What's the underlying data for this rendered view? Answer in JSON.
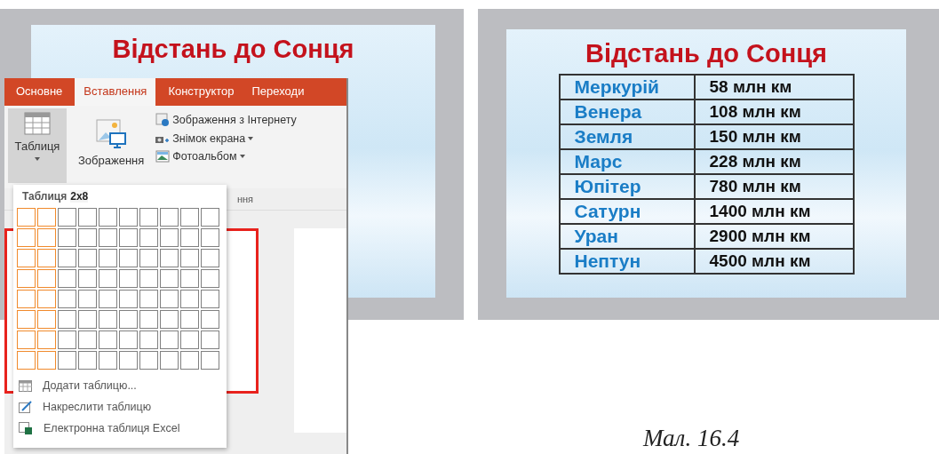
{
  "left_slide": {
    "title": "Відстань до Сонця"
  },
  "ribbon": {
    "tabs": [
      {
        "label": "Основне",
        "selected": false
      },
      {
        "label": "Вставлення",
        "selected": true
      },
      {
        "label": "Конструктор",
        "selected": false
      },
      {
        "label": "Переходи",
        "selected": false
      }
    ],
    "table_button": {
      "label": "Таблиця",
      "expanded": true
    },
    "picture_button": {
      "label": "Зображення"
    },
    "small_buttons": [
      {
        "label": "Зображення з Інтернету",
        "kind": "online",
        "dropdown": false
      },
      {
        "label": "Знімок екрана",
        "kind": "screenshot",
        "dropdown": true
      },
      {
        "label": "Фотоальбом",
        "kind": "album",
        "dropdown": true
      }
    ],
    "group_label": "ння"
  },
  "table_menu": {
    "header": "Таблиця",
    "size": "2x8",
    "grid": [
      {
        "cells": [
          {
            "selected": true
          },
          {
            "selected": true
          },
          {
            "selected": false
          },
          {
            "selected": false
          },
          {
            "selected": false
          },
          {
            "selected": false
          },
          {
            "selected": false
          },
          {
            "selected": false
          },
          {
            "selected": false
          },
          {
            "selected": false
          }
        ]
      },
      {
        "cells": [
          {
            "selected": true
          },
          {
            "selected": true
          },
          {
            "selected": false
          },
          {
            "selected": false
          },
          {
            "selected": false
          },
          {
            "selected": false
          },
          {
            "selected": false
          },
          {
            "selected": false
          },
          {
            "selected": false
          },
          {
            "selected": false
          }
        ]
      },
      {
        "cells": [
          {
            "selected": true
          },
          {
            "selected": true
          },
          {
            "selected": false
          },
          {
            "selected": false
          },
          {
            "selected": false
          },
          {
            "selected": false
          },
          {
            "selected": false
          },
          {
            "selected": false
          },
          {
            "selected": false
          },
          {
            "selected": false
          }
        ]
      },
      {
        "cells": [
          {
            "selected": true
          },
          {
            "selected": true
          },
          {
            "selected": false
          },
          {
            "selected": false
          },
          {
            "selected": false
          },
          {
            "selected": false
          },
          {
            "selected": false
          },
          {
            "selected": false
          },
          {
            "selected": false
          },
          {
            "selected": false
          }
        ]
      },
      {
        "cells": [
          {
            "selected": true
          },
          {
            "selected": true
          },
          {
            "selected": false
          },
          {
            "selected": false
          },
          {
            "selected": false
          },
          {
            "selected": false
          },
          {
            "selected": false
          },
          {
            "selected": false
          },
          {
            "selected": false
          },
          {
            "selected": false
          }
        ]
      },
      {
        "cells": [
          {
            "selected": true
          },
          {
            "selected": true
          },
          {
            "selected": false
          },
          {
            "selected": false
          },
          {
            "selected": false
          },
          {
            "selected": false
          },
          {
            "selected": false
          },
          {
            "selected": false
          },
          {
            "selected": false
          },
          {
            "selected": false
          }
        ]
      },
      {
        "cells": [
          {
            "selected": true
          },
          {
            "selected": true
          },
          {
            "selected": false
          },
          {
            "selected": false
          },
          {
            "selected": false
          },
          {
            "selected": false
          },
          {
            "selected": false
          },
          {
            "selected": false
          },
          {
            "selected": false
          },
          {
            "selected": false
          }
        ]
      },
      {
        "cells": [
          {
            "selected": true
          },
          {
            "selected": true
          },
          {
            "selected": false
          },
          {
            "selected": false
          },
          {
            "selected": false
          },
          {
            "selected": false
          },
          {
            "selected": false
          },
          {
            "selected": false
          },
          {
            "selected": false
          },
          {
            "selected": false
          }
        ]
      }
    ],
    "items": [
      {
        "label": "Додати таблицю...",
        "kind": "insert"
      },
      {
        "label": "Накреслити таблицю",
        "kind": "draw"
      },
      {
        "label": "Електронна таблиця Excel",
        "kind": "excel"
      }
    ]
  },
  "right_slide": {
    "title": "Відстань до Сонця",
    "rows": [
      {
        "planet": "Меркурій",
        "distance": "58 млн км"
      },
      {
        "planet": "Венера",
        "distance": "108 млн км"
      },
      {
        "planet": "Земля",
        "distance": "150 млн км"
      },
      {
        "planet": "Марс",
        "distance": "228 млн км"
      },
      {
        "planet": "Юпітер",
        "distance": "780 млн км"
      },
      {
        "planet": "Сатурн",
        "distance": "1400 млн км"
      },
      {
        "planet": "Уран",
        "distance": "2900 млн км"
      },
      {
        "planet": "Нептун",
        "distance": "4500 млн км"
      }
    ]
  },
  "caption": "Мал. 16.4"
}
